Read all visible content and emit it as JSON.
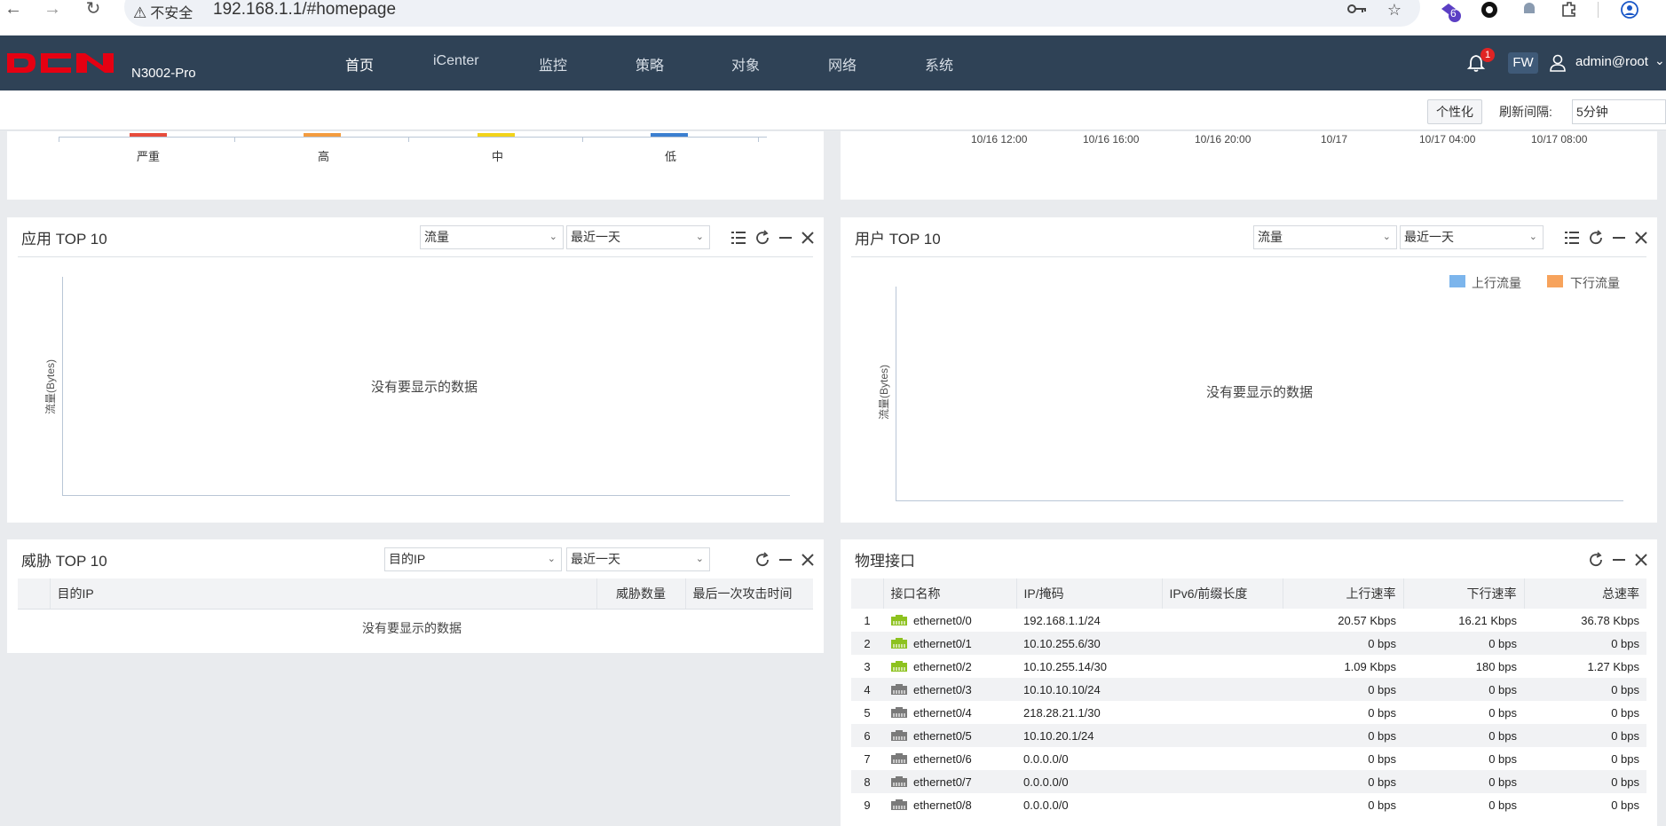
{
  "browser": {
    "security_warning": "不安全",
    "url": "192.168.1.1/#homepage",
    "extension_badge": "6"
  },
  "header": {
    "brand": "DCN",
    "model": "N3002-Pro",
    "menu": [
      {
        "label": "首页",
        "active": true
      },
      {
        "label": "iCenter",
        "active": false
      },
      {
        "label": "监控",
        "active": false
      },
      {
        "label": "策略",
        "active": false
      },
      {
        "label": "对象",
        "active": false
      },
      {
        "label": "网络",
        "active": false
      },
      {
        "label": "系统",
        "active": false
      }
    ],
    "notification_count": "1",
    "mode_badge": "FW",
    "user": "admin@root"
  },
  "toolbar": {
    "personalize_label": "个性化",
    "refresh_label": "刷新间隔:",
    "refresh_value": "5分钟"
  },
  "severity_panel": {
    "categories": [
      {
        "label": "严重",
        "color": "#e74c3c"
      },
      {
        "label": "高",
        "color": "#f39c3f"
      },
      {
        "label": "中",
        "color": "#f2d31b"
      },
      {
        "label": "低",
        "color": "#3b7fd0"
      }
    ]
  },
  "timeline_panel": {
    "ticks": [
      "10/16 12:00",
      "10/16 16:00",
      "10/16 20:00",
      "10/17",
      "10/17 04:00",
      "10/17 08:00"
    ]
  },
  "app_top10": {
    "title": "应用 TOP 10",
    "metric": "流量",
    "period": "最近一天",
    "ylabel": "流量(Bytes)",
    "empty": "没有要显示的数据"
  },
  "user_top10": {
    "title": "用户 TOP 10",
    "metric": "流量",
    "period": "最近一天",
    "ylabel": "流量(Bytes)",
    "empty": "没有要显示的数据",
    "legend": [
      {
        "label": "上行流量",
        "color": "#7cb5ec"
      },
      {
        "label": "下行流量",
        "color": "#f7a35c"
      }
    ]
  },
  "threat_top10": {
    "title": "威胁 TOP 10",
    "metric": "目的IP",
    "period": "最近一天",
    "columns": [
      "目的IP",
      "威胁数量",
      "最后一次攻击时间"
    ],
    "empty": "没有要显示的数据"
  },
  "interfaces": {
    "title": "物理接口",
    "columns": [
      "接口名称",
      "IP/掩码",
      "IPv6/前缀长度",
      "上行速率",
      "下行速率",
      "总速率"
    ],
    "rows": [
      {
        "no": "1",
        "name": "ethernet0/0",
        "ip": "192.168.1.1/24",
        "ipv6": "",
        "up": "20.57 Kbps",
        "down": "16.21 Kbps",
        "total": "36.78 Kbps",
        "active": true
      },
      {
        "no": "2",
        "name": "ethernet0/1",
        "ip": "10.10.255.6/30",
        "ipv6": "",
        "up": "0 bps",
        "down": "0 bps",
        "total": "0 bps",
        "active": true
      },
      {
        "no": "3",
        "name": "ethernet0/2",
        "ip": "10.10.255.14/30",
        "ipv6": "",
        "up": "1.09 Kbps",
        "down": "180 bps",
        "total": "1.27 Kbps",
        "active": true
      },
      {
        "no": "4",
        "name": "ethernet0/3",
        "ip": "10.10.10.10/24",
        "ipv6": "",
        "up": "0 bps",
        "down": "0 bps",
        "total": "0 bps",
        "active": false
      },
      {
        "no": "5",
        "name": "ethernet0/4",
        "ip": "218.28.21.1/30",
        "ipv6": "",
        "up": "0 bps",
        "down": "0 bps",
        "total": "0 bps",
        "active": false
      },
      {
        "no": "6",
        "name": "ethernet0/5",
        "ip": "10.10.20.1/24",
        "ipv6": "",
        "up": "0 bps",
        "down": "0 bps",
        "total": "0 bps",
        "active": false
      },
      {
        "no": "7",
        "name": "ethernet0/6",
        "ip": "0.0.0.0/0",
        "ipv6": "",
        "up": "0 bps",
        "down": "0 bps",
        "total": "0 bps",
        "active": false
      },
      {
        "no": "8",
        "name": "ethernet0/7",
        "ip": "0.0.0.0/0",
        "ipv6": "",
        "up": "0 bps",
        "down": "0 bps",
        "total": "0 bps",
        "active": false
      },
      {
        "no": "9",
        "name": "ethernet0/8",
        "ip": "0.0.0.0/0",
        "ipv6": "",
        "up": "0 bps",
        "down": "0 bps",
        "total": "0 bps",
        "active": false
      }
    ]
  },
  "colors": {
    "header_bg": "#2f4256",
    "port_active": "#8dc21f",
    "port_inactive": "#7a7a7a",
    "brand_red": "#e60012"
  }
}
